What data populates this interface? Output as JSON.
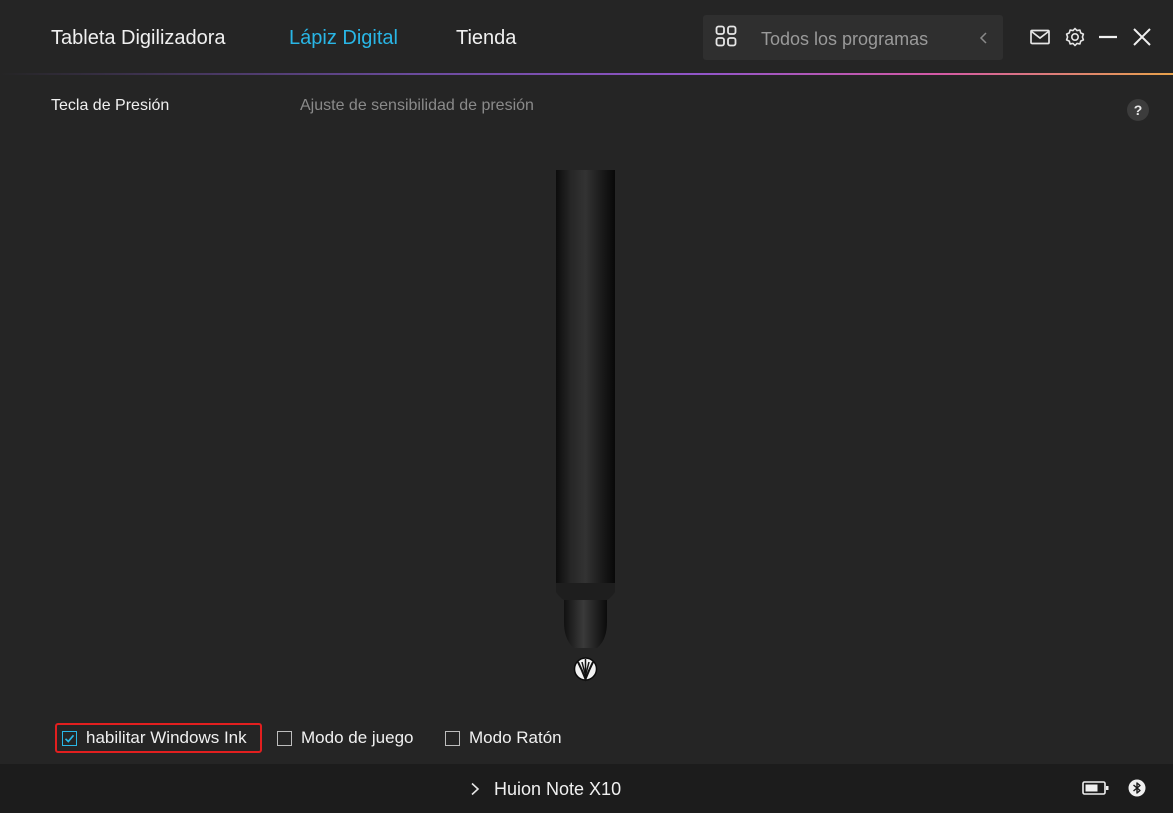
{
  "nav": {
    "tabs": [
      {
        "label": "Tableta Digilizadora",
        "active": false
      },
      {
        "label": "Lápiz Digital",
        "active": true
      },
      {
        "label": "Tienda",
        "active": false
      }
    ],
    "program_selector": {
      "label": "Todos los programas",
      "icon": "grid-icon",
      "back_icon": "chevron-left-icon"
    },
    "window_icons": [
      "mail-icon",
      "gear-icon",
      "minimize-icon",
      "close-icon"
    ]
  },
  "colors": {
    "accent": "#29b6e6",
    "background": "#252525",
    "bottom_bar": "#1c1c1c",
    "highlight": "#e21f1f"
  },
  "content": {
    "section_title": "Tecla de Presión",
    "section_subtitle": "Ajuste de sensibilidad de presión",
    "help_label": "?"
  },
  "options": [
    {
      "label": "habilitar Windows Ink",
      "checked": true
    },
    {
      "label": "Modo de juego",
      "checked": false
    },
    {
      "label": "Modo Ratón",
      "checked": false
    }
  ],
  "footer": {
    "device_name": "Huion Note X10",
    "status_icons": [
      "battery-icon",
      "bluetooth-icon"
    ]
  }
}
